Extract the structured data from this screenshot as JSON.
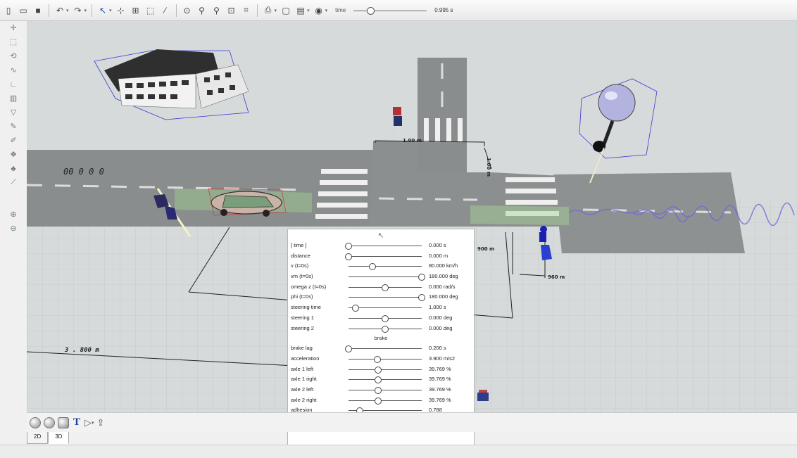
{
  "toolbar": {
    "time_label": "time",
    "time_value": "0.995 s",
    "time_fraction": 0.2
  },
  "left_tools": [
    "move-icon",
    "select-icon",
    "rotate-icon",
    "path-icon",
    "measure-icon",
    "wall-icon",
    "polygon-icon",
    "brush-icon",
    "pencil-icon",
    "object-icon",
    "tree-icon",
    "ramp-icon",
    "zoom-in-icon",
    "zoom-out-icon"
  ],
  "scene": {
    "labels": {
      "road_text": "00 0 0 0",
      "dim_top": "1.00 m",
      "dim_right": "1.00 m",
      "dim_mid": "900 m",
      "dim_bike": "960 m",
      "dim_left": "3 . 800 m"
    }
  },
  "params": {
    "header_icon": "cursor-arrow-icon",
    "rows_top": [
      {
        "label": "[ time ]",
        "value": "0.000 s",
        "pos": 0.0
      },
      {
        "label": "distance",
        "value": "0.000 m",
        "pos": 0.0
      },
      {
        "label": "v (t=0s)",
        "value": "80.000 km/h",
        "pos": 0.33
      },
      {
        "label": "vm (t=0s)",
        "value": "180.000 deg",
        "pos": 1.0
      },
      {
        "label": "omega z (t=0s)",
        "value": "0.000 rad/s",
        "pos": 0.5
      },
      {
        "label": "phi (t=0s)",
        "value": "180.000 deg",
        "pos": 1.0
      },
      {
        "label": "steering time",
        "value": "1.000 s",
        "pos": 0.1
      },
      {
        "label": "steering 1",
        "value": "0.000 deg",
        "pos": 0.5
      },
      {
        "label": "steering 2",
        "value": "0.000 deg",
        "pos": 0.5
      }
    ],
    "section_label": "brake",
    "rows_bottom": [
      {
        "label": "brake lag",
        "value": "0.200 s",
        "pos": 0.0
      },
      {
        "label": "acceleration",
        "value": "3.900 m/s2",
        "pos": 0.39
      },
      {
        "label": "axle 1 left",
        "value": "39.769 %",
        "pos": 0.4
      },
      {
        "label": "axle 1 right",
        "value": "39.769 %",
        "pos": 0.4
      },
      {
        "label": "axle 2 left",
        "value": "39.769 %",
        "pos": 0.4
      },
      {
        "label": "axle 2 right",
        "value": "39.769 %",
        "pos": 0.4
      },
      {
        "label": "adhesion",
        "value": "0.788",
        "pos": 0.15
      }
    ]
  },
  "tabs": [
    "2D",
    "3D"
  ],
  "active_tab": "3D"
}
